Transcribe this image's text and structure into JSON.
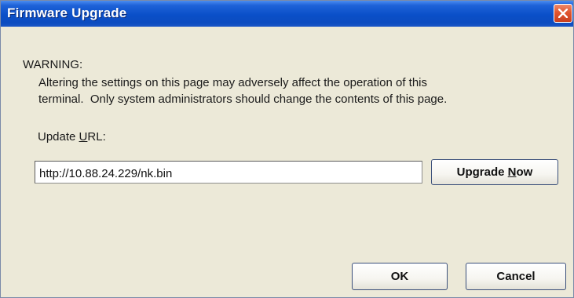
{
  "window": {
    "title": "Firmware Upgrade",
    "close_icon": "close-icon"
  },
  "warning": {
    "heading": "WARNING:",
    "line1": "Altering the settings on this page may adversely affect the operation of this",
    "line2": "terminal.  Only system administrators should change the contents of this page."
  },
  "update": {
    "label_prefix": "Update ",
    "label_underlined": "U",
    "label_suffix": "RL:",
    "url_value": "http://10.88.24.229/nk.bin",
    "upgrade_prefix": "Upgrade ",
    "upgrade_underlined": "N",
    "upgrade_suffix": "ow"
  },
  "buttons": {
    "ok": "OK",
    "cancel": "Cancel"
  },
  "colors": {
    "titlebar": "#0a4fc8",
    "dialog_bg": "#ece9d8",
    "close_button": "#e0552f"
  }
}
